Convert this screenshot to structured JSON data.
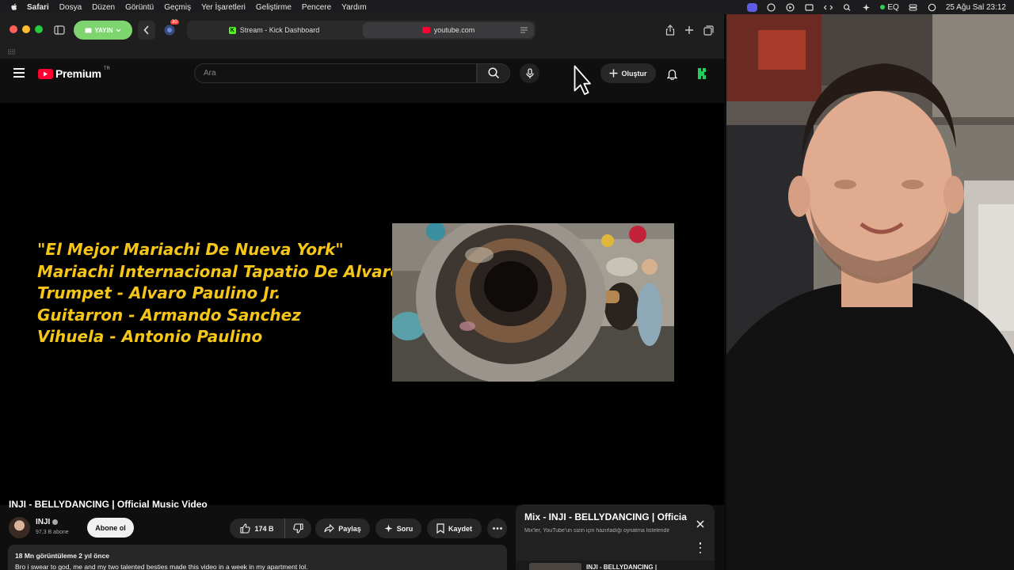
{
  "menubar": {
    "app": "Safari",
    "items": [
      "Dosya",
      "Düzen",
      "Görüntü",
      "Geçmiş",
      "Yer İşaretleri",
      "Geliştirme",
      "Pencere",
      "Yardım"
    ],
    "status_eq": "EQ",
    "datetime": "25 Ağu Sal  23:12"
  },
  "safari": {
    "profile_label": "YAYIN",
    "extension_badge": "30",
    "tabs": [
      {
        "title": "Stream - Kick Dashboard",
        "favicon": "kick-icon",
        "active": false
      },
      {
        "title": "youtube.com",
        "favicon": "youtube-icon",
        "active": true
      }
    ]
  },
  "youtube": {
    "brand": "Premium",
    "region": "TR",
    "search_placeholder": "Ara",
    "create_label": "Oluştur"
  },
  "video": {
    "credits": [
      "\"El Mejor Mariachi De Nueva York\"",
      "Mariachi Internacional Tapatio De Alvaro Paulino",
      "Trumpet - Alvaro Paulino Jr.",
      "Guitarron - Armando Sanchez",
      "Vihuela - Antonio Paulino"
    ],
    "credits_color": "#f5c518",
    "title": "INJI - BELLYDANCING | Official Music Video",
    "channel_name": "INJI",
    "subscribers": "97,3 B abone",
    "subscribe_label": "Abone ol",
    "likes": "174 B",
    "share_label": "Paylaş",
    "ask_label": "Soru",
    "save_label": "Kaydet",
    "views_age": "18 Mn görüntüleme  2 yıl önce",
    "description": "Bro i swear to god, me and my two talented besties made this video in a week in my apartment lol."
  },
  "mix": {
    "title": "Mix - INJI - BELLYDANCING | Official Music Video",
    "subtitle": "Mix'ler, YouTube'un sizin için hazırladığı oynatma listeleridir",
    "first_item_title": "INJI - BELLYDANCING |"
  },
  "colors": {
    "youtube_red": "#ff0033",
    "safari_profile_green": "#7ed56f",
    "kick_green": "#53fc18"
  }
}
